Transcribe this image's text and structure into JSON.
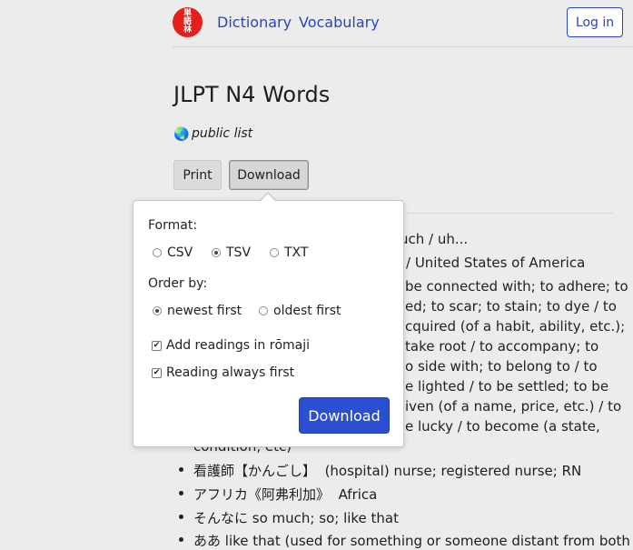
{
  "nav": {
    "logo_chars": [
      "単",
      "語",
      "林"
    ],
    "dictionary": "Dictionary",
    "vocabulary": "Vocabulary",
    "login": "Log in"
  },
  "page": {
    "title": "JLPT N4 Words",
    "visibility": "public list"
  },
  "toolbar": {
    "print": "Print",
    "download": "Download"
  },
  "popover": {
    "format_label": "Format:",
    "formats": [
      "CSV",
      "TSV",
      "TXT"
    ],
    "selected_format": "TSV",
    "order_label": "Order by:",
    "orders": [
      "newest first",
      "oldest first"
    ],
    "selected_order": "newest first",
    "checkboxes": [
      {
        "label": "Add readings in rōmaji",
        "checked": true
      },
      {
        "label": "Reading always first",
        "checked": true
      }
    ],
    "download_button": "Download"
  },
  "behind_text": [
    "uch / uh...",
    "/ United States of America",
    "be connected with; to adhere; to",
    "ed; to scar; to stain; to dye / to",
    "cquired (of a habit, ability, etc.);",
    "take root / to accompany; to",
    "o side with; to belong to / to",
    "e lighted / to be settled; to be",
    "iven (of a name, price, etc.) / to",
    "e lucky / to become (a state,",
    "condition, etc)"
  ],
  "list": [
    {
      "word": "看護師【かんごし】",
      "meaning": "(hospital) nurse; registered nurse; RN"
    },
    {
      "word": "アフリカ《阿弗利加》",
      "meaning": "Africa"
    },
    {
      "word": "そんなに",
      "meaning": "so much; so; like that"
    },
    {
      "word": "ああ",
      "meaning": "like that (used for something or someone distant from both"
    }
  ]
}
